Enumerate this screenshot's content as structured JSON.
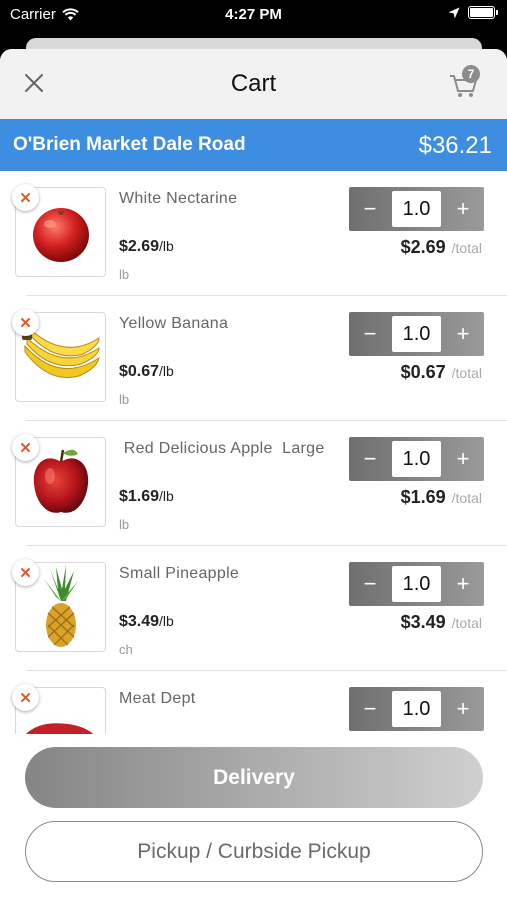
{
  "status_bar": {
    "carrier": "Carrier",
    "time": "4:27 PM"
  },
  "nav": {
    "title": "Cart",
    "cart_count": "7",
    "close_icon": "close-icon",
    "cart_icon": "shopping-cart-icon"
  },
  "store": {
    "name": "O'Brien Market Dale Road",
    "total": "$36.21",
    "color": "#3d8de0"
  },
  "items": [
    {
      "name": "White Nectarine",
      "price": "$2.69",
      "price_unit": "/lb",
      "unit": "lb",
      "qty": "1.0",
      "line_total": "$2.69",
      "total_label": "/total",
      "image": "nectarine"
    },
    {
      "name": "Yellow Banana",
      "price": "$0.67",
      "price_unit": "/lb",
      "unit": "lb",
      "qty": "1.0",
      "line_total": "$0.67",
      "total_label": "/total",
      "image": "banana"
    },
    {
      "name": " Red Delicious Apple  Large",
      "price": "$1.69",
      "price_unit": "/lb",
      "unit": "lb",
      "qty": "1.0",
      "line_total": "$1.69",
      "total_label": "/total",
      "image": "apple"
    },
    {
      "name": "Small Pineapple",
      "price": "$3.49",
      "price_unit": "/lb",
      "unit": "ch",
      "qty": "1.0",
      "line_total": "$3.49",
      "total_label": "/total",
      "image": "pineapple"
    },
    {
      "name": "Meat Dept",
      "qty": "1.0",
      "image": "meat"
    }
  ],
  "stepper": {
    "minus": "−",
    "plus": "+"
  },
  "actions": {
    "delivery": "Delivery",
    "pickup": "Pickup / Curbside Pickup"
  }
}
